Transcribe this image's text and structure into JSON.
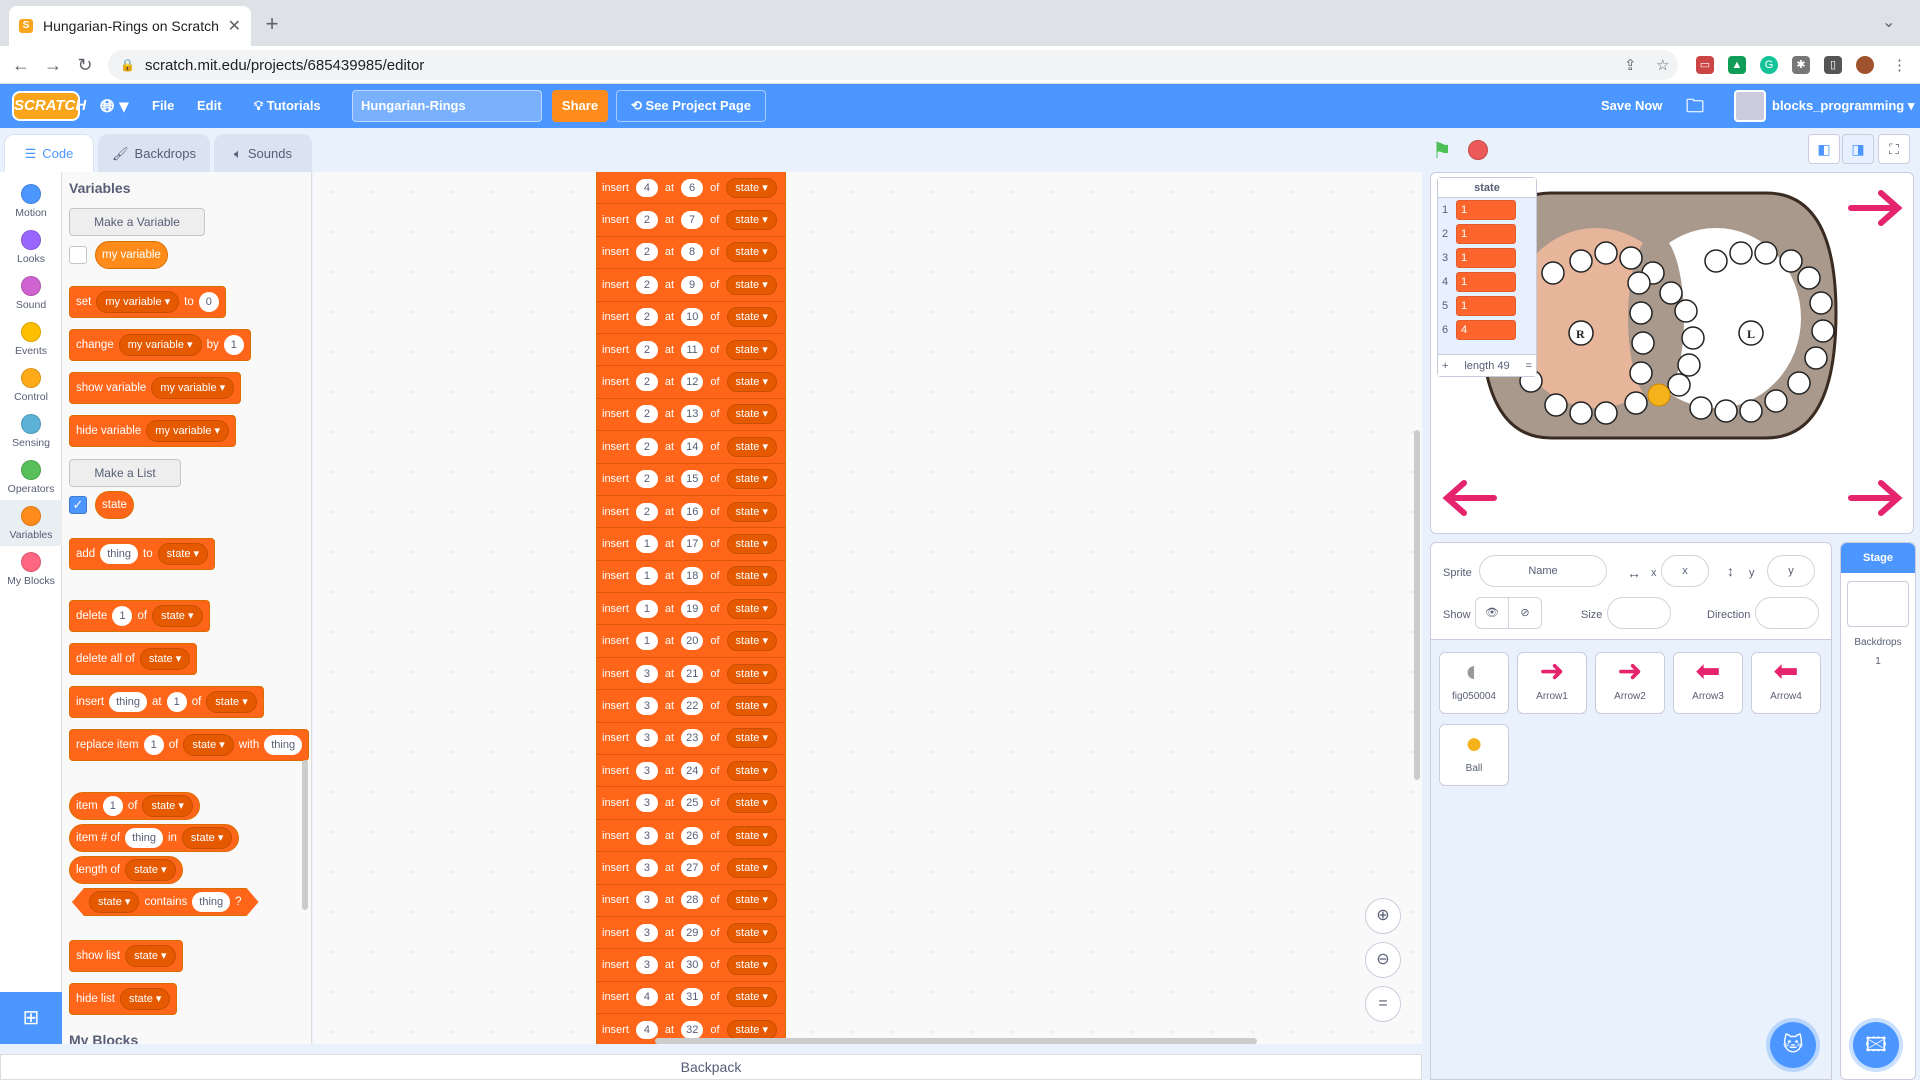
{
  "browser": {
    "tab_title": "Hungarian-Rings on Scratch",
    "url": "scratch.mit.edu/projects/685439985/editor"
  },
  "menu": {
    "logo": "SCRATCH",
    "file": "File",
    "edit": "Edit",
    "tutorials": "Tutorials",
    "project_title": "Hungarian-Rings",
    "share": "Share",
    "see_project": "See Project Page",
    "save_now": "Save Now",
    "username": "blocks_programming"
  },
  "editor_tabs": {
    "code": "Code",
    "backdrops": "Backdrops",
    "sounds": "Sounds"
  },
  "categories": [
    {
      "label": "Motion",
      "color": "#4c97ff"
    },
    {
      "label": "Looks",
      "color": "#9966ff"
    },
    {
      "label": "Sound",
      "color": "#cf63cf"
    },
    {
      "label": "Events",
      "color": "#ffbf00"
    },
    {
      "label": "Control",
      "color": "#ffab19"
    },
    {
      "label": "Sensing",
      "color": "#5cb1d6"
    },
    {
      "label": "Operators",
      "color": "#59c059"
    },
    {
      "label": "Variables",
      "color": "#ff8c1a"
    },
    {
      "label": "My Blocks",
      "color": "#ff6680"
    }
  ],
  "palette": {
    "title": "Variables",
    "make_variable": "Make a Variable",
    "my_variable": "my variable",
    "make_list": "Make a List",
    "list_name": "state",
    "my_blocks_title": "My Blocks",
    "b_set": "set",
    "b_to": "to",
    "b_set_val": "0",
    "b_change": "change",
    "b_by": "by",
    "b_change_val": "1",
    "b_show_var": "show variable",
    "b_hide_var": "hide variable",
    "b_add": "add",
    "b_thing": "thing",
    "b_delete": "delete",
    "b_of": "of",
    "b_one": "1",
    "b_delete_all": "delete all of",
    "b_insert": "insert",
    "b_at": "at",
    "b_replace": "replace item",
    "b_with": "with",
    "b_item": "item",
    "b_item_num": "item # of",
    "b_in": "in",
    "b_length": "length of",
    "b_contains": "contains",
    "b_q": "?",
    "b_show_list": "show list",
    "b_hide_list": "hide list"
  },
  "script_rows": [
    {
      "v": "4",
      "i": "6"
    },
    {
      "v": "2",
      "i": "7"
    },
    {
      "v": "2",
      "i": "8"
    },
    {
      "v": "2",
      "i": "9"
    },
    {
      "v": "2",
      "i": "10"
    },
    {
      "v": "2",
      "i": "11"
    },
    {
      "v": "2",
      "i": "12"
    },
    {
      "v": "2",
      "i": "13"
    },
    {
      "v": "2",
      "i": "14"
    },
    {
      "v": "2",
      "i": "15"
    },
    {
      "v": "2",
      "i": "16"
    },
    {
      "v": "1",
      "i": "17"
    },
    {
      "v": "1",
      "i": "18"
    },
    {
      "v": "1",
      "i": "19"
    },
    {
      "v": "1",
      "i": "20"
    },
    {
      "v": "3",
      "i": "21"
    },
    {
      "v": "3",
      "i": "22"
    },
    {
      "v": "3",
      "i": "23"
    },
    {
      "v": "3",
      "i": "24"
    },
    {
      "v": "3",
      "i": "25"
    },
    {
      "v": "3",
      "i": "26"
    },
    {
      "v": "3",
      "i": "27"
    },
    {
      "v": "3",
      "i": "28"
    },
    {
      "v": "3",
      "i": "29"
    },
    {
      "v": "3",
      "i": "30"
    },
    {
      "v": "4",
      "i": "31"
    },
    {
      "v": "4",
      "i": "32"
    }
  ],
  "script_words": {
    "insert": "insert",
    "at": "at",
    "of": "of",
    "list": "state"
  },
  "backpack": "Backpack",
  "list_monitor": {
    "title": "state",
    "items": [
      {
        "n": "1",
        "v": "1"
      },
      {
        "n": "2",
        "v": "1"
      },
      {
        "n": "3",
        "v": "1"
      },
      {
        "n": "4",
        "v": "1"
      },
      {
        "n": "5",
        "v": "1"
      },
      {
        "n": "6",
        "v": "4"
      }
    ],
    "plus": "+",
    "length": "length 49",
    "eq": "="
  },
  "sprite_info": {
    "sprite_label": "Sprite",
    "name_ph": "Name",
    "x_label": "x",
    "x_ph": "x",
    "y_label": "y",
    "y_ph": "y",
    "show_label": "Show",
    "size_label": "Size",
    "direction_label": "Direction"
  },
  "sprites": [
    {
      "name": "fig050004",
      "icon": "toggle-icon"
    },
    {
      "name": "Arrow1",
      "icon": "arrow-right-icon"
    },
    {
      "name": "Arrow2",
      "icon": "arrow-right-icon"
    },
    {
      "name": "Arrow3",
      "icon": "arrow-left-icon"
    },
    {
      "name": "Arrow4",
      "icon": "arrow-left-icon"
    },
    {
      "name": "Ball",
      "icon": "ball-icon"
    }
  ],
  "stage_pane": {
    "title": "Stage",
    "backdrops_label": "Backdrops",
    "backdrops_count": "1"
  },
  "colors": {
    "accent": "#4c97ff",
    "variables": "#ff8c1a",
    "list_block": "#ff661a"
  }
}
